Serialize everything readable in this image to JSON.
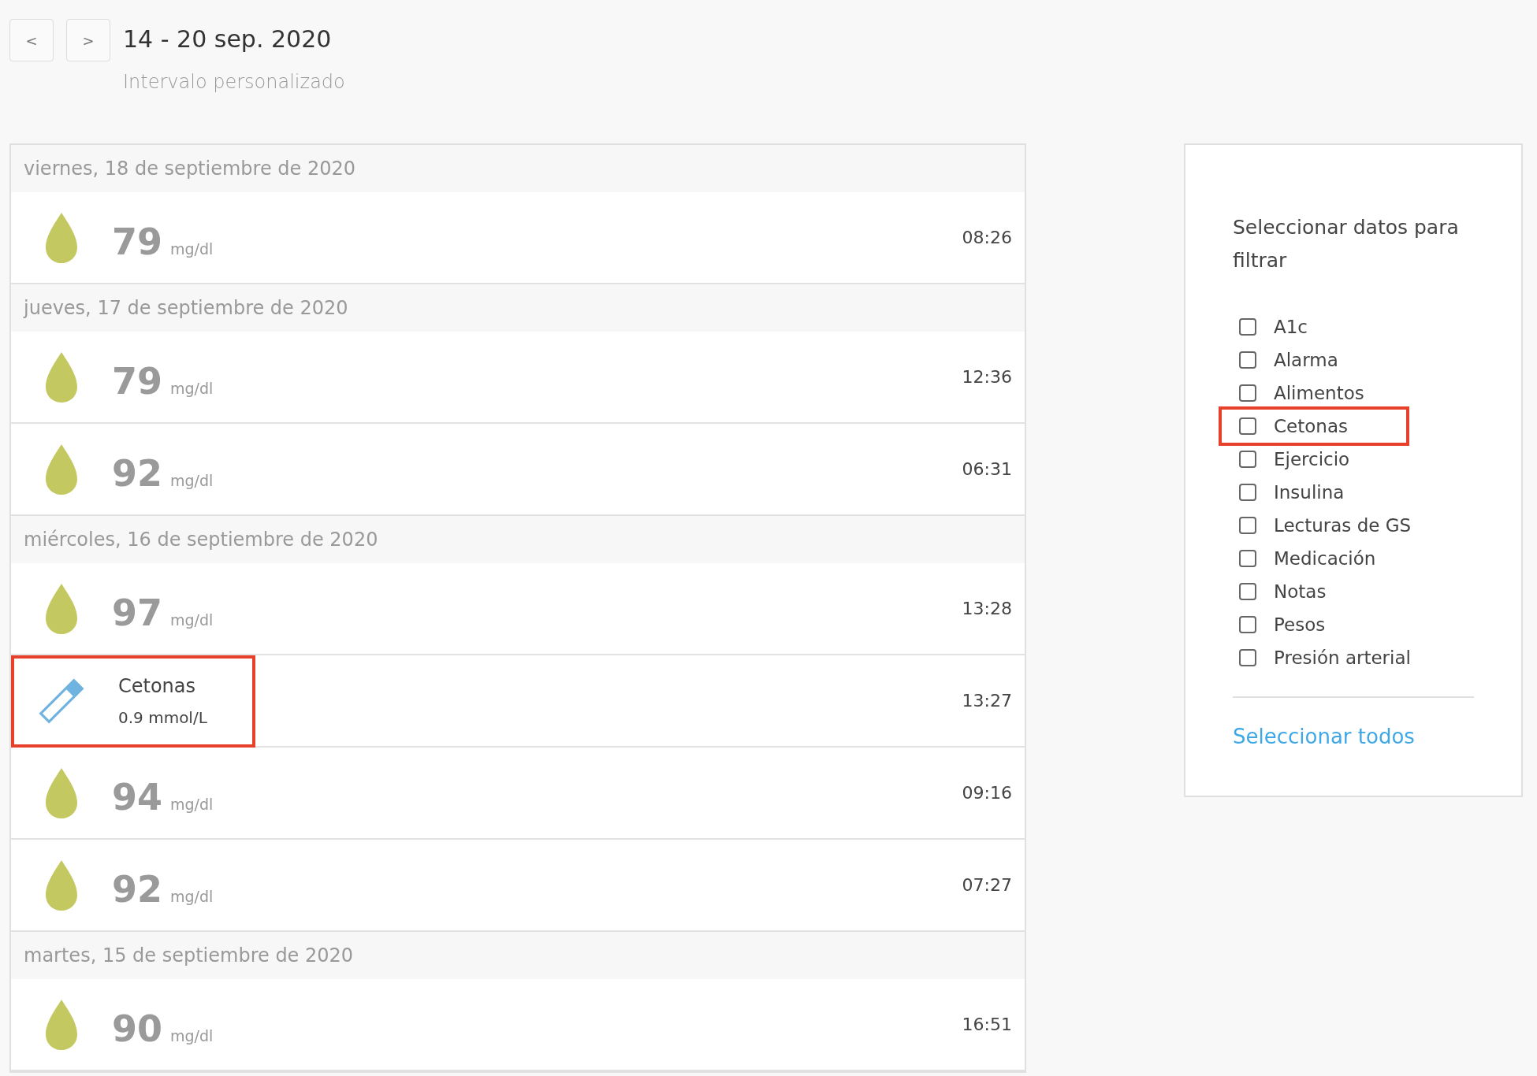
{
  "nav": {
    "prev": "<",
    "next": ">",
    "range": "14 - 20 sep. 2020",
    "subtitle": "Intervalo personalizado"
  },
  "days": [
    {
      "date": "viernes, 18 de septiembre de 2020",
      "entries": [
        {
          "kind": "glucose",
          "value": "79",
          "unit": "mg/dl",
          "time": "08:26",
          "highlighted": false
        }
      ]
    },
    {
      "date": "jueves, 17 de septiembre de 2020",
      "entries": [
        {
          "kind": "glucose",
          "value": "79",
          "unit": "mg/dl",
          "time": "12:36",
          "highlighted": false
        },
        {
          "kind": "glucose",
          "value": "92",
          "unit": "mg/dl",
          "time": "06:31",
          "highlighted": false
        }
      ]
    },
    {
      "date": "miércoles, 16 de septiembre de 2020",
      "entries": [
        {
          "kind": "glucose",
          "value": "97",
          "unit": "mg/dl",
          "time": "13:28",
          "highlighted": false
        },
        {
          "kind": "ketone",
          "label": "Cetonas",
          "value": "0.9 mmol/L",
          "time": "13:27",
          "highlighted": true
        },
        {
          "kind": "glucose",
          "value": "94",
          "unit": "mg/dl",
          "time": "09:16",
          "highlighted": false
        },
        {
          "kind": "glucose",
          "value": "92",
          "unit": "mg/dl",
          "time": "07:27",
          "highlighted": false
        }
      ]
    },
    {
      "date": "martes, 15 de septiembre de 2020",
      "entries": [
        {
          "kind": "glucose",
          "value": "90",
          "unit": "mg/dl",
          "time": "16:51",
          "highlighted": false
        }
      ]
    }
  ],
  "filter": {
    "title": "Seleccionar datos para filtrar",
    "options": [
      {
        "label": "A1c",
        "checked": false,
        "highlighted": false
      },
      {
        "label": "Alarma",
        "checked": false,
        "highlighted": false
      },
      {
        "label": "Alimentos",
        "checked": false,
        "highlighted": false
      },
      {
        "label": "Cetonas",
        "checked": false,
        "highlighted": true
      },
      {
        "label": "Ejercicio",
        "checked": false,
        "highlighted": false
      },
      {
        "label": "Insulina",
        "checked": false,
        "highlighted": false
      },
      {
        "label": "Lecturas de GS",
        "checked": false,
        "highlighted": false
      },
      {
        "label": "Medicación",
        "checked": false,
        "highlighted": false
      },
      {
        "label": "Notas",
        "checked": false,
        "highlighted": false
      },
      {
        "label": "Pesos",
        "checked": false,
        "highlighted": false
      },
      {
        "label": "Presión arterial",
        "checked": false,
        "highlighted": false
      }
    ],
    "select_all": "Seleccionar todos"
  }
}
